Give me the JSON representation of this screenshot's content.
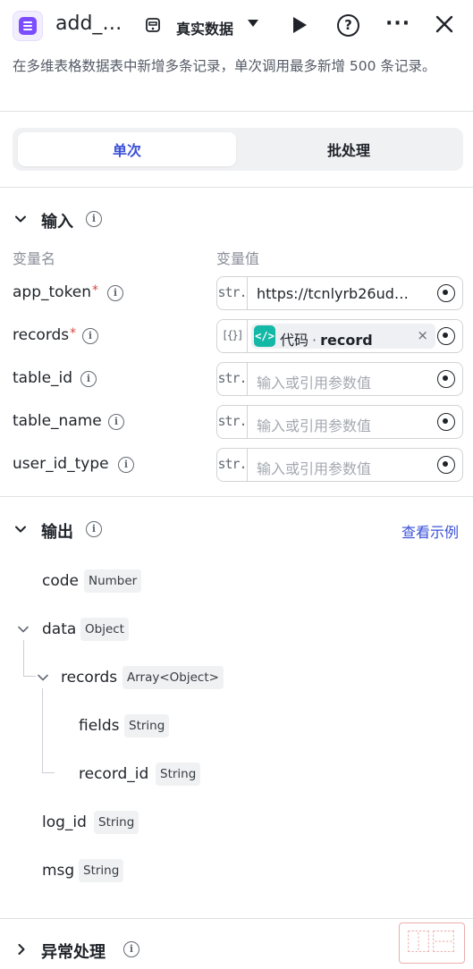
{
  "header": {
    "title": "add_…",
    "data_source_label": "真实数据",
    "app_icon": "list-icon",
    "icons": [
      "datasource-icon",
      "chevron-down-icon",
      "play-icon",
      "help-icon",
      "more-icon",
      "close-icon"
    ]
  },
  "description": "在多维表格数据表中新增多条记录，单次调用最多新增 500 条记录。",
  "tabs": [
    {
      "label": "单次",
      "active": true
    },
    {
      "label": "批处理",
      "active": false
    }
  ],
  "input_section": {
    "title": "输入",
    "col_name": "变量名",
    "col_value": "变量值",
    "params": [
      {
        "name": "app_token",
        "required": true,
        "type": "str.",
        "value": "https://tcnlyrb26ud…",
        "placeholder": ""
      },
      {
        "name": "records",
        "required": true,
        "type": "[{}]",
        "ref_source": "代码",
        "ref_sep": "·",
        "ref_name": "record"
      },
      {
        "name": "table_id",
        "required": false,
        "type": "str.",
        "value": "",
        "placeholder": "输入或引用参数值"
      },
      {
        "name": "table_name",
        "required": false,
        "type": "str.",
        "value": "",
        "placeholder": "输入或引用参数值"
      },
      {
        "name": "user_id_type",
        "required": false,
        "type": "str.",
        "value": "",
        "placeholder": "输入或引用参数值"
      }
    ],
    "required_mark": "*",
    "clear_mark": "×"
  },
  "output_section": {
    "title": "输出",
    "example_link": "查看示例",
    "fields": [
      {
        "name": "code",
        "type": "Number"
      },
      {
        "name": "data",
        "type": "Object"
      },
      {
        "name": "records",
        "type": "Array<Object>"
      },
      {
        "name": "fields",
        "type": "String"
      },
      {
        "name": "record_id",
        "type": "String"
      },
      {
        "name": "log_id",
        "type": "String"
      },
      {
        "name": "msg",
        "type": "String"
      }
    ]
  },
  "exception_section": {
    "title": "异常处理"
  },
  "colors": {
    "accent": "#3b50d8",
    "app_icon": "#7b4dff",
    "code_icon": "#14b8a6",
    "required": "#e0443d"
  }
}
